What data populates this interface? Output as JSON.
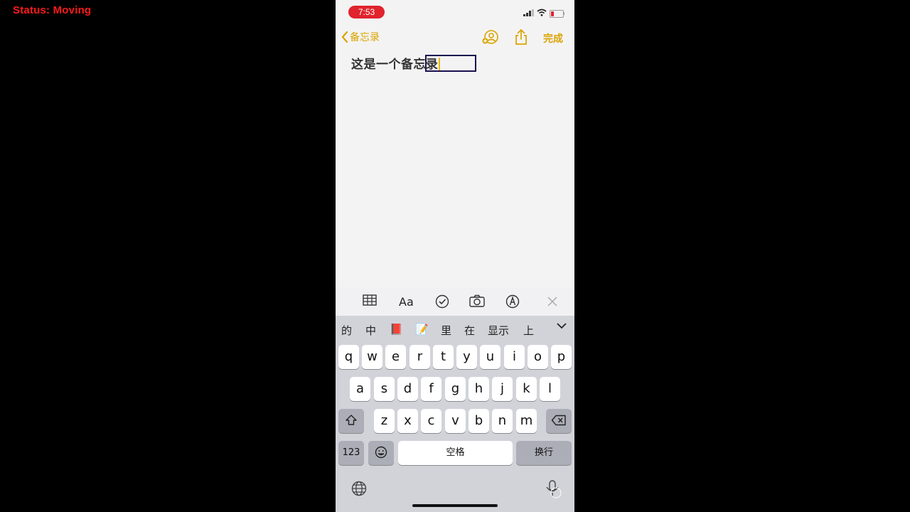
{
  "overlay": {
    "status": "Status: Moving"
  },
  "statusbar": {
    "time": "7:53"
  },
  "nav": {
    "back_label": "备忘录",
    "done_label": "完成"
  },
  "note": {
    "text": "这是一个备忘录"
  },
  "toolbar": {
    "format_label": "Aa"
  },
  "candidates": [
    "的",
    "中",
    "📕",
    "📝",
    "里",
    "在",
    "显示",
    "上"
  ],
  "keyboard": {
    "row1": [
      "q",
      "w",
      "e",
      "r",
      "t",
      "y",
      "u",
      "i",
      "o",
      "p"
    ],
    "row2": [
      "a",
      "s",
      "d",
      "f",
      "g",
      "h",
      "j",
      "k",
      "l"
    ],
    "row3": [
      "z",
      "x",
      "c",
      "v",
      "b",
      "n",
      "m"
    ],
    "numbers_label": "123",
    "space_label": "空格",
    "return_label": "换行"
  },
  "colors": {
    "accent": "#d9a400",
    "time_pill": "#e0232d",
    "overlay_text": "#ff1a1a"
  }
}
